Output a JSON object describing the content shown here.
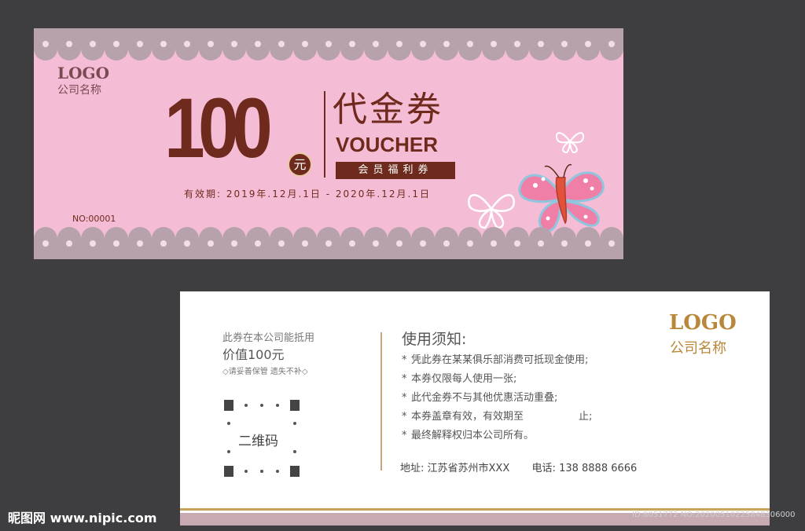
{
  "front": {
    "logo": "LOGO",
    "company": "公司名称",
    "amount": "100",
    "currency": "元",
    "title_cn": "代金券",
    "title_en": "VOUCHER",
    "badge": "会员福利券",
    "validity": "有效期: 2019年.12月.1日 - 2020年.12月.1日",
    "serial": "NO:00001",
    "colors": {
      "background": "#f5bcd6",
      "accent": "#6e2a1c",
      "lace": "#b7a2ac"
    },
    "decorations": [
      "lace-border-top",
      "lace-border-bottom",
      "butterfly-icon",
      "outline-butterfly-icon"
    ]
  },
  "back": {
    "line1": "此券在本公司能抵用",
    "line2": "价值100元",
    "line3": "◇请妥善保管 遗失不补◇",
    "qr_label": "二维码",
    "rules_title": "使用须知:",
    "rules": [
      {
        "text": "凭此券在某某俱乐部消费可抵现金使用;",
        "tail": ""
      },
      {
        "text": "本券仅限每人使用一张;",
        "tail": ""
      },
      {
        "text": "此代金券不与其他优惠活动重叠;",
        "tail": ""
      },
      {
        "text": "本券盖章有效，有效期至",
        "tail": "止;"
      },
      {
        "text": "最终解释权归本公司所有。",
        "tail": ""
      }
    ],
    "address_label": "地址:",
    "address": "江苏省苏州市XXX",
    "phone_label": "电话:",
    "phone": "138 8888 6666",
    "logo": "LOGO",
    "company": "公司名称",
    "colors": {
      "gold": "#b8873a",
      "band": "#c8aab3"
    }
  },
  "watermark": {
    "site": "昵图网 www.nipic.com",
    "id": "ID:8051772 NO:20200510225848306000"
  }
}
